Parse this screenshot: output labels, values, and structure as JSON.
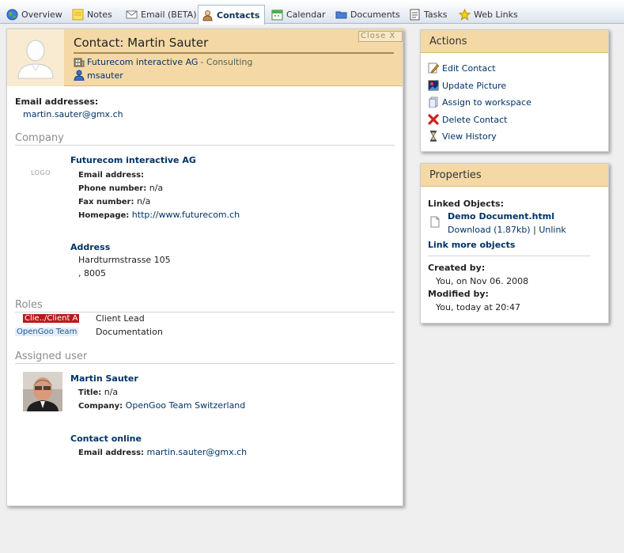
{
  "tabs": [
    {
      "label": "Overview",
      "icon": "globe-icon"
    },
    {
      "label": "Notes",
      "icon": "note-icon"
    },
    {
      "label": "Email (BETA)",
      "icon": "envelope-icon"
    },
    {
      "label": "Contacts",
      "icon": "contact-person-icon",
      "active": true
    },
    {
      "label": "Calendar",
      "icon": "calendar-icon"
    },
    {
      "label": "Documents",
      "icon": "folder-icon"
    },
    {
      "label": "Tasks",
      "icon": "tasks-icon"
    },
    {
      "label": "Web Links",
      "icon": "star-icon"
    }
  ],
  "header": {
    "title": "Contact: Martin Sauter",
    "close_label": "Close X",
    "company_name": "Futurecom interactive AG",
    "company_suffix": " - Consulting",
    "username": "msauter"
  },
  "email_section": {
    "label": "Email addresses:",
    "value": "martin.sauter@gmx.ch"
  },
  "company_section": {
    "heading": "Company",
    "logo_text": "LOGO",
    "name": "Futurecom interactive AG",
    "email_label": "Email address:",
    "email_value": "",
    "phone_label": "Phone number:",
    "phone_value": "n/a",
    "fax_label": "Fax number:",
    "fax_value": "n/a",
    "homepage_label": "Homepage:",
    "homepage_value": "http://www.futurecom.ch",
    "address_heading": "Address",
    "address_line1": "Hardturmstrasse 105",
    "address_line2": ", 8005"
  },
  "roles_section": {
    "heading": "Roles",
    "roles": [
      {
        "tag": "Clie../Client A",
        "role": "Client Lead",
        "tag_bg": "#b71c1c",
        "tag_fg": "#ffffff"
      },
      {
        "tag": "OpenGoo Team",
        "role": "Documentation",
        "tag_bg": "#e4eefa",
        "tag_fg": "#225599"
      }
    ]
  },
  "assigned_section": {
    "heading": "Assigned user",
    "name": "Martin Sauter",
    "title_label": "Title:",
    "title_value": "n/a",
    "company_label": "Company:",
    "company_value": "OpenGoo Team Switzerland",
    "online_heading": "Contact online",
    "online_email_label": "Email address:",
    "online_email_value": "martin.sauter@gmx.ch"
  },
  "actions_panel": {
    "title": "Actions",
    "items": [
      {
        "label": "Edit Contact",
        "icon": "pencil-icon"
      },
      {
        "label": "Update Picture",
        "icon": "picture-icon"
      },
      {
        "label": "Assign to workspace",
        "icon": "workspace-icon"
      },
      {
        "label": "Delete Contact",
        "icon": "delete-x-icon"
      },
      {
        "label": "View History",
        "icon": "hourglass-icon"
      }
    ]
  },
  "properties_panel": {
    "title": "Properties",
    "linked_label": "Linked Objects:",
    "linked_doc": "Demo Document.html",
    "download": "Download (1.87kb)",
    "separator": "|",
    "unlink": "Unlink",
    "link_more": "Link more objects",
    "created_label": "Created by:",
    "created_value": "You, on Nov 06. 2008",
    "modified_label": "Modified by:",
    "modified_value": "You, today at 20:47"
  },
  "colors": {
    "header_bg": "#f4d9a6",
    "link": "#003366",
    "delete_red": "#cc2222"
  }
}
